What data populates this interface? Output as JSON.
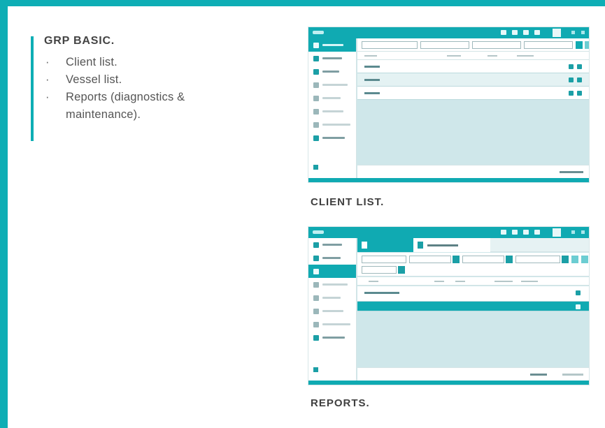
{
  "intro": {
    "title": "GRP BASIC.",
    "bullets": [
      "Client list.",
      "Vessel list.",
      "Reports (diagnostics & maintenance)."
    ]
  },
  "captions": {
    "client_list": "CLIENT LIST.",
    "reports": "REPORTS."
  },
  "colors": {
    "accent": "#0eaeb5",
    "panel": "#cfe7ea"
  }
}
